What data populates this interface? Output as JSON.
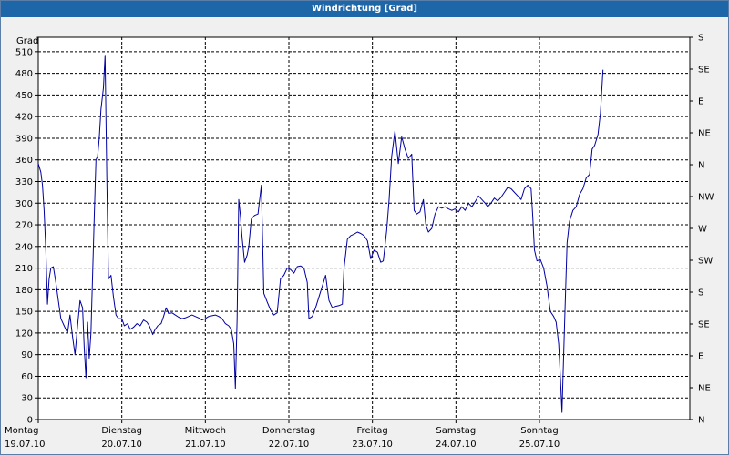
{
  "window": {
    "title": "Windrichtung [Grad]"
  },
  "chart_data": {
    "type": "line",
    "title": "Windrichtung [Grad]",
    "ylabel": "Grad",
    "ylim": [
      0,
      530
    ],
    "yticks": [
      0,
      30,
      60,
      90,
      120,
      150,
      180,
      210,
      240,
      270,
      300,
      330,
      360,
      390,
      420,
      450,
      480,
      510
    ],
    "y2ticks": [
      {
        "value": 0,
        "label": "N"
      },
      {
        "value": 45,
        "label": "NE"
      },
      {
        "value": 90,
        "label": "E"
      },
      {
        "value": 135,
        "label": "SE"
      },
      {
        "value": 180,
        "label": "S"
      },
      {
        "value": 225,
        "label": "SW"
      },
      {
        "value": 270,
        "label": "W"
      },
      {
        "value": 315,
        "label": "NW"
      },
      {
        "value": 360,
        "label": "N"
      },
      {
        "value": 405,
        "label": "NE"
      },
      {
        "value": 450,
        "label": "E"
      },
      {
        "value": 495,
        "label": "SE"
      },
      {
        "value": 540,
        "label": "S"
      }
    ],
    "xlim": [
      0,
      7.8
    ],
    "xticks": [
      {
        "x": 0,
        "day": "Montag",
        "date": "19.07.10"
      },
      {
        "x": 1,
        "day": "Dienstag",
        "date": "20.07.10"
      },
      {
        "x": 2,
        "day": "Mittwoch",
        "date": "21.07.10"
      },
      {
        "x": 3,
        "day": "Donnerstag",
        "date": "22.07.10"
      },
      {
        "x": 4,
        "day": "Freitag",
        "date": "23.07.10"
      },
      {
        "x": 5,
        "day": "Samstag",
        "date": "24.07.10"
      },
      {
        "x": 6,
        "day": "Sonntag",
        "date": "25.07.10"
      }
    ],
    "grid": true,
    "series": [
      {
        "color": "#0000a0",
        "points": [
          [
            0.0,
            355
          ],
          [
            0.03,
            343
          ],
          [
            0.05,
            325
          ],
          [
            0.07,
            290
          ],
          [
            0.09,
            235
          ],
          [
            0.11,
            160
          ],
          [
            0.13,
            195
          ],
          [
            0.15,
            210
          ],
          [
            0.18,
            212
          ],
          [
            0.21,
            190
          ],
          [
            0.24,
            165
          ],
          [
            0.27,
            140
          ],
          [
            0.31,
            130
          ],
          [
            0.35,
            120
          ],
          [
            0.38,
            145
          ],
          [
            0.41,
            115
          ],
          [
            0.44,
            90
          ],
          [
            0.47,
            130
          ],
          [
            0.5,
            165
          ],
          [
            0.53,
            155
          ],
          [
            0.55,
            100
          ],
          [
            0.57,
            58
          ],
          [
            0.59,
            135
          ],
          [
            0.61,
            85
          ],
          [
            0.63,
            120
          ],
          [
            0.65,
            200
          ],
          [
            0.67,
            280
          ],
          [
            0.69,
            360
          ],
          [
            0.71,
            365
          ],
          [
            0.73,
            390
          ],
          [
            0.75,
            430
          ],
          [
            0.78,
            460
          ],
          [
            0.8,
            505
          ],
          [
            0.82,
            335
          ],
          [
            0.84,
            195
          ],
          [
            0.87,
            200
          ],
          [
            0.9,
            170
          ],
          [
            0.93,
            145
          ],
          [
            0.96,
            140
          ],
          [
            1.0,
            140
          ],
          [
            1.03,
            130
          ],
          [
            1.07,
            133
          ],
          [
            1.1,
            125
          ],
          [
            1.14,
            128
          ],
          [
            1.18,
            133
          ],
          [
            1.22,
            130
          ],
          [
            1.26,
            138
          ],
          [
            1.3,
            135
          ],
          [
            1.33,
            130
          ],
          [
            1.37,
            118
          ],
          [
            1.4,
            125
          ],
          [
            1.43,
            130
          ],
          [
            1.47,
            133
          ],
          [
            1.5,
            143
          ],
          [
            1.53,
            155
          ],
          [
            1.56,
            147
          ],
          [
            1.6,
            148
          ],
          [
            1.64,
            145
          ],
          [
            1.68,
            142
          ],
          [
            1.72,
            140
          ],
          [
            1.76,
            141
          ],
          [
            1.8,
            143
          ],
          [
            1.84,
            145
          ],
          [
            1.88,
            143
          ],
          [
            1.92,
            141
          ],
          [
            1.96,
            138
          ],
          [
            2.0,
            140
          ],
          [
            2.04,
            143
          ],
          [
            2.08,
            144
          ],
          [
            2.12,
            145
          ],
          [
            2.16,
            143
          ],
          [
            2.2,
            140
          ],
          [
            2.24,
            133
          ],
          [
            2.28,
            130
          ],
          [
            2.31,
            125
          ],
          [
            2.34,
            105
          ],
          [
            2.36,
            43
          ],
          [
            2.38,
            140
          ],
          [
            2.4,
            305
          ],
          [
            2.42,
            283
          ],
          [
            2.44,
            252
          ],
          [
            2.47,
            218
          ],
          [
            2.5,
            228
          ],
          [
            2.52,
            240
          ],
          [
            2.55,
            278
          ],
          [
            2.59,
            283
          ],
          [
            2.63,
            285
          ],
          [
            2.67,
            325
          ],
          [
            2.7,
            175
          ],
          [
            2.74,
            163
          ],
          [
            2.78,
            152
          ],
          [
            2.82,
            145
          ],
          [
            2.86,
            148
          ],
          [
            2.9,
            195
          ],
          [
            2.94,
            200
          ],
          [
            2.98,
            210
          ],
          [
            3.02,
            208
          ],
          [
            3.06,
            203
          ],
          [
            3.1,
            212
          ],
          [
            3.14,
            213
          ],
          [
            3.18,
            210
          ],
          [
            3.22,
            190
          ],
          [
            3.24,
            140
          ],
          [
            3.28,
            143
          ],
          [
            3.32,
            155
          ],
          [
            3.36,
            170
          ],
          [
            3.4,
            185
          ],
          [
            3.44,
            200
          ],
          [
            3.48,
            165
          ],
          [
            3.52,
            155
          ],
          [
            3.56,
            157
          ],
          [
            3.6,
            158
          ],
          [
            3.64,
            160
          ],
          [
            3.66,
            210
          ],
          [
            3.7,
            250
          ],
          [
            3.74,
            255
          ],
          [
            3.78,
            257
          ],
          [
            3.82,
            260
          ],
          [
            3.86,
            258
          ],
          [
            3.9,
            255
          ],
          [
            3.94,
            248
          ],
          [
            3.98,
            223
          ],
          [
            4.02,
            235
          ],
          [
            4.06,
            232
          ],
          [
            4.1,
            218
          ],
          [
            4.13,
            220
          ],
          [
            4.17,
            262
          ],
          [
            4.2,
            305
          ],
          [
            4.23,
            365
          ],
          [
            4.27,
            400
          ],
          [
            4.31,
            355
          ],
          [
            4.35,
            392
          ],
          [
            4.39,
            375
          ],
          [
            4.43,
            362
          ],
          [
            4.47,
            368
          ],
          [
            4.5,
            290
          ],
          [
            4.53,
            285
          ],
          [
            4.57,
            288
          ],
          [
            4.61,
            305
          ],
          [
            4.64,
            270
          ],
          [
            4.67,
            260
          ],
          [
            4.71,
            265
          ],
          [
            4.75,
            285
          ],
          [
            4.79,
            295
          ],
          [
            4.83,
            293
          ],
          [
            4.87,
            295
          ],
          [
            4.91,
            292
          ],
          [
            4.95,
            290
          ],
          [
            4.99,
            292
          ],
          [
            5.03,
            288
          ],
          [
            5.07,
            295
          ],
          [
            5.11,
            290
          ],
          [
            5.15,
            300
          ],
          [
            5.19,
            295
          ],
          [
            5.23,
            302
          ],
          [
            5.27,
            310
          ],
          [
            5.31,
            305
          ],
          [
            5.35,
            300
          ],
          [
            5.38,
            295
          ],
          [
            5.42,
            300
          ],
          [
            5.46,
            307
          ],
          [
            5.5,
            303
          ],
          [
            5.54,
            308
          ],
          [
            5.58,
            315
          ],
          [
            5.62,
            322
          ],
          [
            5.66,
            320
          ],
          [
            5.7,
            315
          ],
          [
            5.74,
            310
          ],
          [
            5.78,
            305
          ],
          [
            5.82,
            320
          ],
          [
            5.86,
            325
          ],
          [
            5.9,
            320
          ],
          [
            5.92,
            280
          ],
          [
            5.94,
            235
          ],
          [
            5.97,
            220
          ],
          [
            6.01,
            222
          ],
          [
            6.05,
            210
          ],
          [
            6.09,
            185
          ],
          [
            6.13,
            150
          ],
          [
            6.17,
            143
          ],
          [
            6.2,
            135
          ],
          [
            6.23,
            105
          ],
          [
            6.25,
            60
          ],
          [
            6.27,
            10
          ],
          [
            6.3,
            130
          ],
          [
            6.33,
            245
          ],
          [
            6.36,
            275
          ],
          [
            6.4,
            290
          ],
          [
            6.44,
            295
          ],
          [
            6.48,
            312
          ],
          [
            6.52,
            320
          ],
          [
            6.56,
            335
          ],
          [
            6.6,
            340
          ],
          [
            6.63,
            375
          ],
          [
            6.66,
            380
          ],
          [
            6.7,
            395
          ],
          [
            6.73,
            425
          ],
          [
            6.76,
            485
          ]
        ]
      }
    ]
  }
}
